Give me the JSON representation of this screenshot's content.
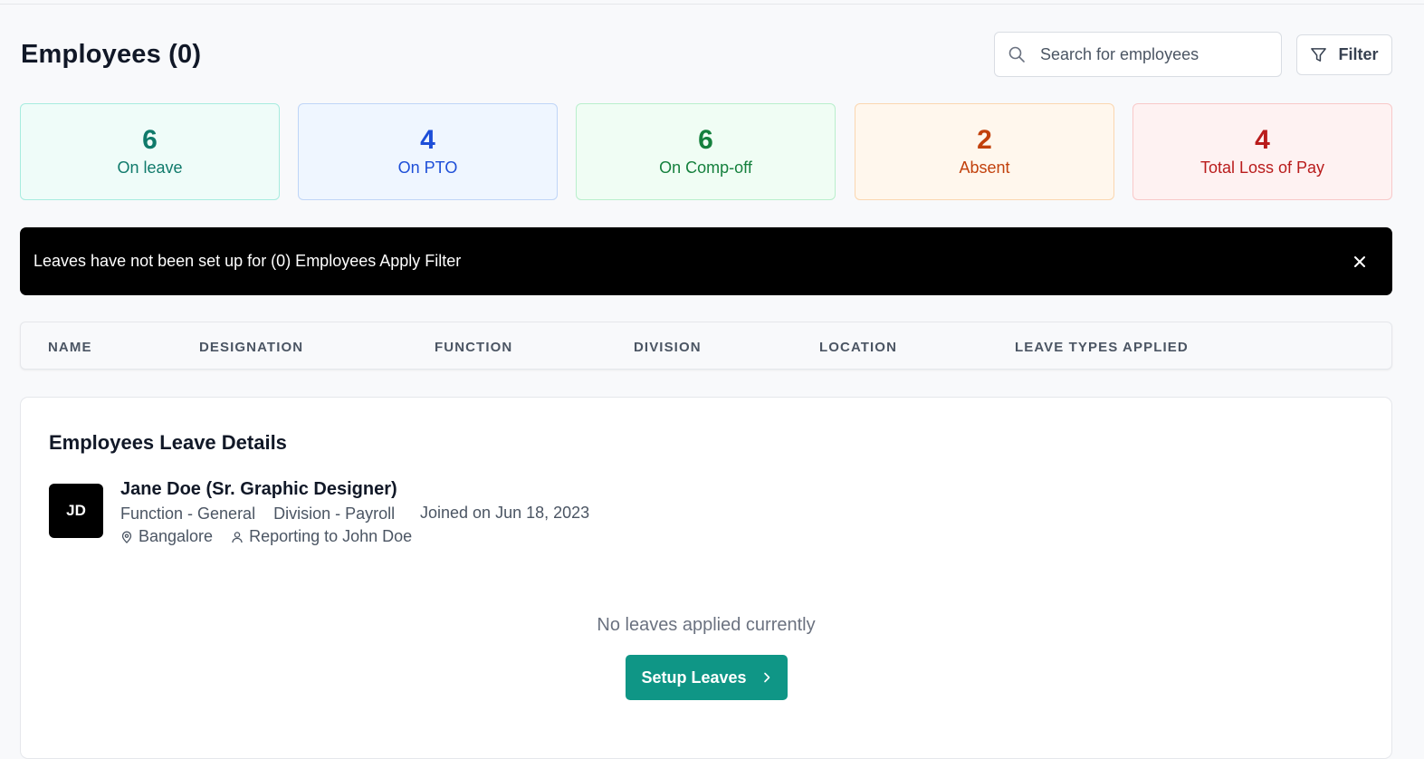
{
  "header": {
    "title": "Employees (0)",
    "search_placeholder": "Search for employees",
    "filter_label": "Filter"
  },
  "stats": [
    {
      "value": "6",
      "label": "On leave",
      "color": "#0f7a6b",
      "bg": "#effcf9",
      "border": "#a7ecdf"
    },
    {
      "value": "4",
      "label": "On PTO",
      "color": "#1d4ed8",
      "bg": "#eff6ff",
      "border": "#bfd5f7"
    },
    {
      "value": "6",
      "label": "On Comp-off",
      "color": "#15803d",
      "bg": "#f0fdf4",
      "border": "#b9efcc"
    },
    {
      "value": "2",
      "label": "Absent",
      "color": "#c2410c",
      "bg": "#fff7ed",
      "border": "#fbd7b0"
    },
    {
      "value": "4",
      "label": "Total Loss of Pay",
      "color": "#b91c1c",
      "bg": "#fef2f2",
      "border": "#f8c9c9"
    }
  ],
  "banner": {
    "text": "Leaves have not been set up for (0) Employees Apply Filter"
  },
  "table": {
    "columns": [
      "NAME",
      "DESIGNATION",
      "FUNCTION",
      "DIVISION",
      "LOCATION",
      "LEAVE TYPES APPLIED"
    ]
  },
  "details": {
    "title": "Employees Leave Details",
    "employee": {
      "initials": "JD",
      "name": "Jane Doe (Sr. Graphic Designer)",
      "function": "Function - General",
      "division": "Division - Payroll",
      "location": "Bangalore",
      "reporting": "Reporting to John Doe",
      "joined": "Joined on Jun 18, 2023"
    },
    "empty_message": "No leaves applied currently",
    "setup_label": "Setup Leaves"
  },
  "colors": {
    "accent": "#0f9686",
    "banner_bg": "#000000"
  }
}
